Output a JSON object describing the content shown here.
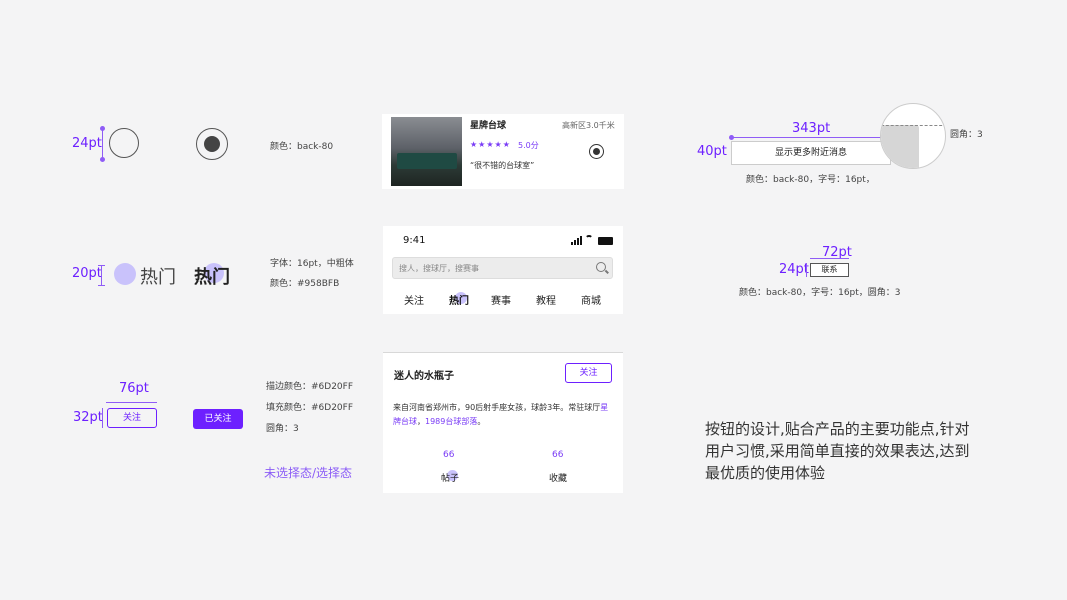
{
  "radio": {
    "size_label": "24pt",
    "color_note": "颜色：back-80"
  },
  "hot_tab": {
    "size_label": "20pt",
    "label": "热门",
    "font_note": "字体：16pt，中粗体",
    "color_note": "颜色：#958BFB"
  },
  "follow_btn": {
    "width_label": "76pt",
    "height_label": "32pt",
    "label": "关注",
    "followed_label": "已关注",
    "stroke_note": "描边颜色：#6D20FF",
    "fill_note": "填充颜色：#6D20FF",
    "radius_note": "圆角：3",
    "state_caption": "未选择态/选择态"
  },
  "venue_card": {
    "name": "星牌台球",
    "distance": "高新区3.0千米",
    "stars": "★★★★★",
    "score": "5.0分",
    "review": "“很不错的台球室”"
  },
  "phone": {
    "time": "9:41",
    "search_placeholder": "搜人，搜球厅，搜赛事",
    "tabs": [
      "关注",
      "热门",
      "赛事",
      "教程",
      "商城"
    ]
  },
  "profile_card": {
    "name": "迷人的水瓶子",
    "follow": "关注",
    "bio_prefix": "来自河南省郑州市，90后射手座女孩，球龄3年。常驻球厅",
    "link1": "星牌台球",
    "sep": "，",
    "link2": "1989台球部落",
    "bio_suffix": "。",
    "stats": [
      {
        "value": "66",
        "label": "帖子"
      },
      {
        "value": "66",
        "label": "收藏"
      }
    ]
  },
  "wide_btn": {
    "width_label": "343pt",
    "height_label": "40pt",
    "label": "显示更多附近消息",
    "radius_note": "圆角：3",
    "note": "颜色：back-80，字号：16pt，"
  },
  "contact_btn": {
    "width_label": "72pt",
    "height_label": "24pt",
    "label": "联系",
    "note": "颜色：back-80，字号：16pt，圆角：3"
  },
  "description": {
    "line1": "按钮的设计,贴合产品的主要功能点,针对",
    "line2": "用户习惯,采用简单直接的效果表达,达到",
    "line3": "最优质的使用体验"
  }
}
